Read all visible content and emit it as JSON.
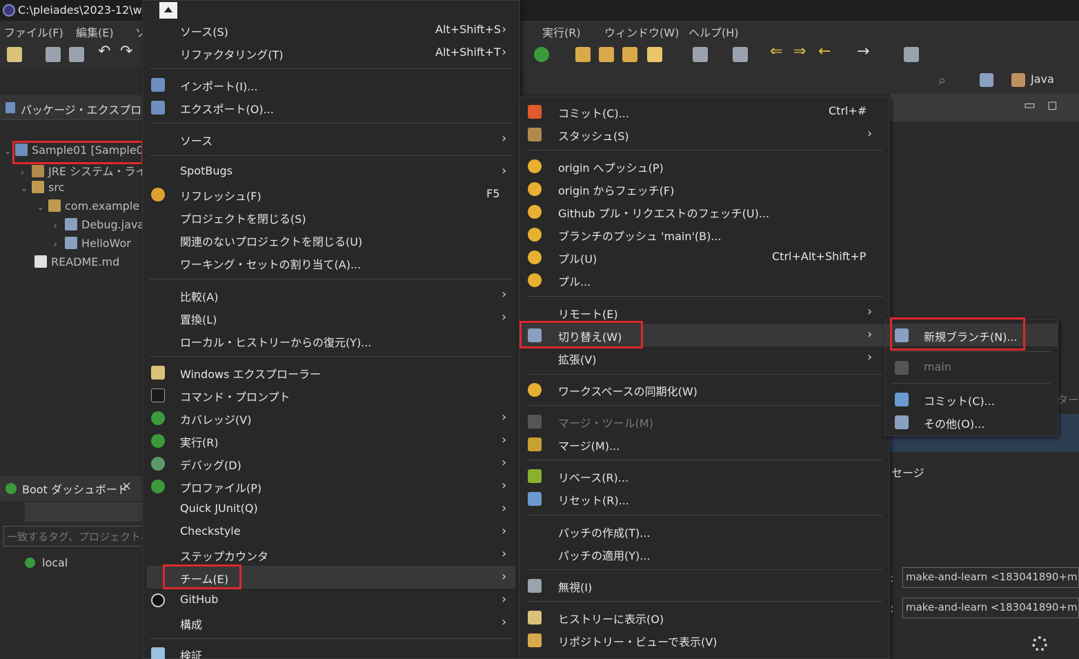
{
  "window": {
    "title": "C:\\pleiades\\2023-12\\w"
  },
  "menubar": {
    "items": [
      "ファイル(F)",
      "編集(E)",
      "実行(R)",
      "ウィンドウ(W)",
      "ヘルプ(H)"
    ],
    "partial": "ソ"
  },
  "perspective": {
    "label": "Java"
  },
  "package_explorer": {
    "tab_label": "パッケージ・エクスプローラー",
    "tree": [
      {
        "label": "Sample01 [Sample0",
        "level": 0,
        "expanded": true
      },
      {
        "label": "JRE システム・ライ",
        "level": 1,
        "expanded": false
      },
      {
        "label": "src",
        "level": 1,
        "expanded": true
      },
      {
        "label": "com.example",
        "level": 2,
        "expanded": true
      },
      {
        "label": "Debug.java",
        "level": 3,
        "expanded": false
      },
      {
        "label": "HelloWor",
        "level": 3,
        "expanded": false
      },
      {
        "label": "README.md",
        "level": 1,
        "expanded": null
      }
    ]
  },
  "boot_dashboard": {
    "tab_label": "Boot ダッシュボード",
    "filter_placeholder": "一致するタグ、プロジェクト、ま",
    "local_label": "local"
  },
  "context_menu": {
    "items": [
      {
        "label": "ソース(S)",
        "accel": "Alt+Shift+S",
        "submenu": true
      },
      {
        "label": "リファクタリング(T)",
        "accel": "Alt+Shift+T",
        "submenu": true
      },
      {
        "label": "インポート(I)...",
        "accel": "",
        "submenu": false
      },
      {
        "label": "エクスポート(O)...",
        "accel": "",
        "submenu": false
      },
      {
        "label": "ソース",
        "accel": "",
        "submenu": true
      },
      {
        "label": "SpotBugs",
        "accel": "",
        "submenu": true
      },
      {
        "label": "リフレッシュ(F)",
        "accel": "F5",
        "submenu": false
      },
      {
        "label": "プロジェクトを閉じる(S)",
        "accel": "",
        "submenu": false
      },
      {
        "label": "関連のないプロジェクトを閉じる(U)",
        "accel": "",
        "submenu": false
      },
      {
        "label": "ワーキング・セットの割り当て(A)...",
        "accel": "",
        "submenu": false
      },
      {
        "label": "比較(A)",
        "accel": "",
        "submenu": true
      },
      {
        "label": "置換(L)",
        "accel": "",
        "submenu": true
      },
      {
        "label": "ローカル・ヒストリーからの復元(Y)...",
        "accel": "",
        "submenu": false
      },
      {
        "label": "Windows エクスプローラー",
        "accel": "",
        "submenu": false
      },
      {
        "label": "コマンド・プロンプト",
        "accel": "",
        "submenu": false
      },
      {
        "label": "カバレッジ(V)",
        "accel": "",
        "submenu": true
      },
      {
        "label": "実行(R)",
        "accel": "",
        "submenu": true
      },
      {
        "label": "デバッグ(D)",
        "accel": "",
        "submenu": true
      },
      {
        "label": "プロファイル(P)",
        "accel": "",
        "submenu": true
      },
      {
        "label": "Quick JUnit(Q)",
        "accel": "",
        "submenu": true
      },
      {
        "label": "Checkstyle",
        "accel": "",
        "submenu": true
      },
      {
        "label": "ステップカウンタ",
        "accel": "",
        "submenu": true
      },
      {
        "label": "チーム(E)",
        "accel": "",
        "submenu": true
      },
      {
        "label": "GitHub",
        "accel": "",
        "submenu": true
      },
      {
        "label": "構成",
        "accel": "",
        "submenu": true
      },
      {
        "label": "検証",
        "accel": "",
        "submenu": false
      }
    ]
  },
  "team_menu": {
    "items": [
      {
        "label": "コミット(C)...",
        "accel": "Ctrl+#",
        "submenu": false
      },
      {
        "label": "スタッシュ(S)",
        "accel": "",
        "submenu": true
      },
      {
        "label": "origin へプッシュ(P)",
        "accel": "",
        "submenu": false
      },
      {
        "label": "origin からフェッチ(F)",
        "accel": "",
        "submenu": false
      },
      {
        "label": "Github プル・リクエストのフェッチ(U)...",
        "accel": "",
        "submenu": false
      },
      {
        "label": "ブランチのプッシュ 'main'(B)...",
        "accel": "",
        "submenu": false
      },
      {
        "label": "プル(U)",
        "accel": "Ctrl+Alt+Shift+P",
        "submenu": false
      },
      {
        "label": "プル...",
        "accel": "",
        "submenu": false
      },
      {
        "label": "リモート(E)",
        "accel": "",
        "submenu": true
      },
      {
        "label": "切り替え(W)",
        "accel": "",
        "submenu": true
      },
      {
        "label": "拡張(V)",
        "accel": "",
        "submenu": true
      },
      {
        "label": "ワークスペースの同期化(W)",
        "accel": "",
        "submenu": false
      },
      {
        "label": "マージ・ツール(M)",
        "accel": "",
        "submenu": false,
        "disabled": true
      },
      {
        "label": "マージ(M)...",
        "accel": "",
        "submenu": false
      },
      {
        "label": "リベース(R)...",
        "accel": "",
        "submenu": false
      },
      {
        "label": "リセット(R)...",
        "accel": "",
        "submenu": false
      },
      {
        "label": "パッチの作成(T)...",
        "accel": "",
        "submenu": false
      },
      {
        "label": "パッチの適用(Y)...",
        "accel": "",
        "submenu": false
      },
      {
        "label": "無視(I)",
        "accel": "",
        "submenu": false
      },
      {
        "label": "ヒストリーに表示(O)",
        "accel": "",
        "submenu": false
      },
      {
        "label": "リポジトリー・ビューで表示(V)",
        "accel": "",
        "submenu": false
      }
    ]
  },
  "switch_menu": {
    "items": [
      {
        "label": "新規ブランチ(N)...",
        "disabled": false
      },
      {
        "label": "main",
        "disabled": true
      },
      {
        "label": "コミット(C)...",
        "disabled": false
      },
      {
        "label": "その他(O)...",
        "disabled": false
      }
    ]
  },
  "git_panel": {
    "label_partial": "セージ",
    "label_partial2": "ター",
    "author_value": "make-and-learn <183041890+m",
    "committer_value": "make-and-learn <183041890+m"
  },
  "colors": {
    "highlight_red": "#e0282d",
    "menu_bg": "#282828"
  }
}
